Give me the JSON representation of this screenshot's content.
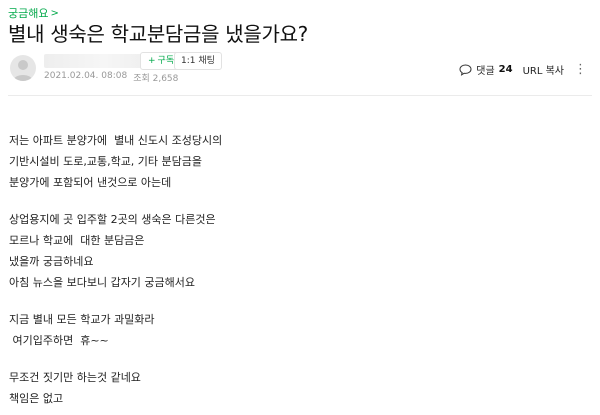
{
  "header": {
    "category": "궁금해요",
    "title": "별내 생숙은 학교분담금을 냈을가요?"
  },
  "author": {
    "follow_label": "구독",
    "chat_label": "1:1 채팅",
    "date": "2021.02.04. 08:08",
    "views": "조회 2,658"
  },
  "actions": {
    "comment_label": "댓글",
    "comment_count": "24",
    "url_copy": "URL 복사",
    "more": "⋮"
  },
  "body": {
    "lines": [
      "저는 아파트 분양가에  별내 신도시 조성당시의",
      "기반시설비 도로,교통,학교, 기타 분담금을",
      "분양가에 포함되어 낸것으로 아는데",
      "",
      "상업용지에 곳 입주할 2곳의 생숙은 다른것은",
      "모르나 학교에  대한 분담금은",
      "냈을까 궁금하네요",
      "아침 뉴스을 보다보니 갑자기 궁금해서요",
      "",
      "지금 별내 모든 학교가 과밀화라",
      " 여기입주하면  휴~~",
      "",
      "무조건 짓기만 하는것 같네요",
      "책임은 없고"
    ]
  }
}
